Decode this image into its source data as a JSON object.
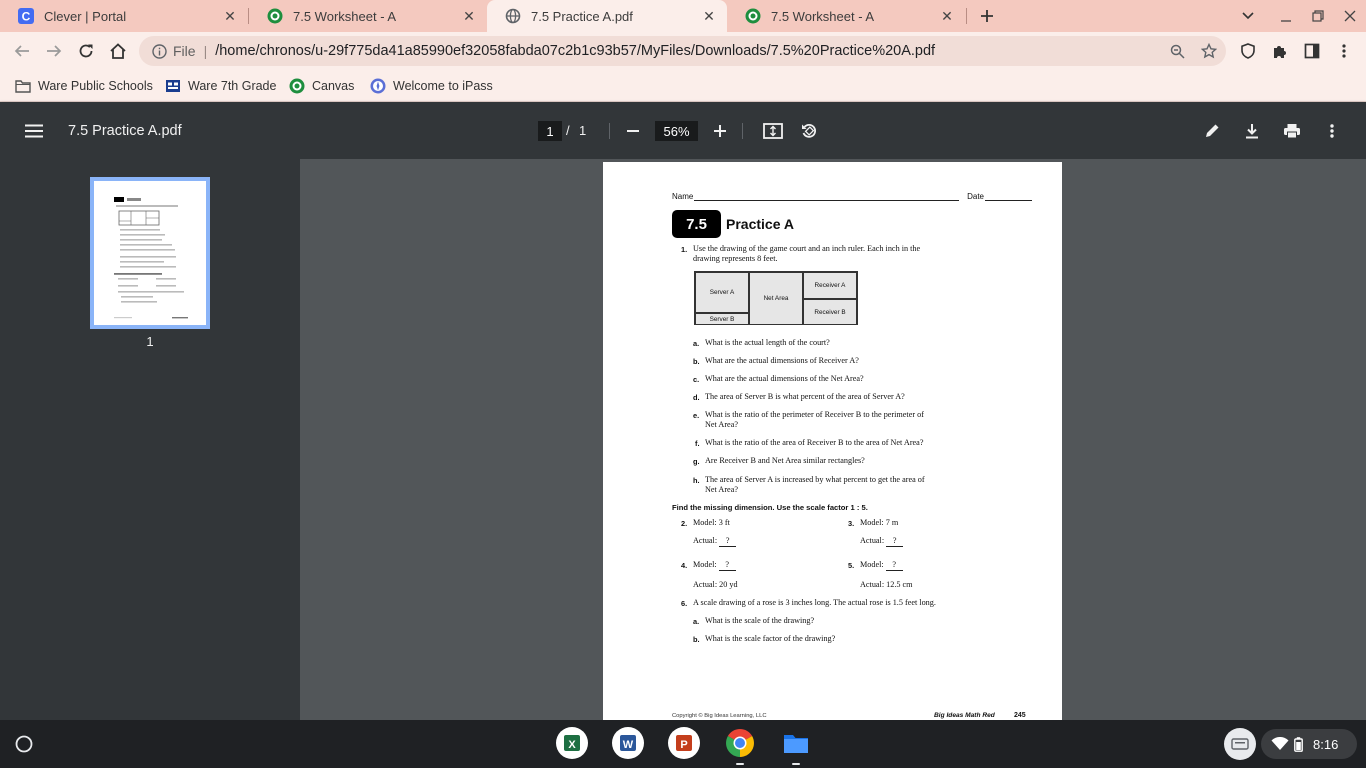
{
  "browser": {
    "tabs": [
      {
        "title": "Clever | Portal",
        "icon": "clever-icon",
        "active": false
      },
      {
        "title": "7.5 Worksheet - A",
        "icon": "worksheet-icon",
        "active": false
      },
      {
        "title": "7.5 Practice A.pdf",
        "icon": "globe-icon",
        "active": true
      },
      {
        "title": "7.5 Worksheet - A",
        "icon": "worksheet-icon",
        "active": false
      }
    ],
    "omnibox": {
      "scheme": "File",
      "url": "/home/chronos/u-29f775da41a85990ef32058fabda07c2b1c93b57/MyFiles/Downloads/7.5%20Practice%20A.pdf"
    },
    "bookmarks": [
      {
        "label": "Ware Public Schools",
        "icon": "folder-icon"
      },
      {
        "label": "Ware 7th Grade",
        "icon": "classroom-icon"
      },
      {
        "label": "Canvas",
        "icon": "worksheet-icon"
      },
      {
        "label": "Welcome to iPass",
        "icon": "ipass-icon"
      }
    ]
  },
  "pdf_viewer": {
    "title": "7.5 Practice A.pdf",
    "current_page": "1",
    "separator": "/",
    "total_pages": "1",
    "zoom": "56%",
    "thumbnail_label": "1"
  },
  "document": {
    "name_label": "Name",
    "date_label": "Date",
    "lesson_badge": "7.5",
    "title": "Practice A",
    "q1": {
      "number": "1.",
      "text_line1": "Use the drawing of the game court and an inch ruler. Each inch in the",
      "text_line2": "drawing represents 8 feet.",
      "court_labels": {
        "server_a": "Server A",
        "server_b": "Server B",
        "net_area": "Net Area",
        "receiver_a": "Receiver A",
        "receiver_b": "Receiver B"
      },
      "parts": [
        {
          "letter": "a.",
          "line1": "What is the actual length of the court?",
          "line2": ""
        },
        {
          "letter": "b.",
          "line1": "What are the actual dimensions of Receiver A?",
          "line2": ""
        },
        {
          "letter": "c.",
          "line1": "What are the actual dimensions of the Net Area?",
          "line2": ""
        },
        {
          "letter": "d.",
          "line1": "The area of Server B is what percent of the area of Server A?",
          "line2": ""
        },
        {
          "letter": "e.",
          "line1": "What is the ratio of the perimeter of Receiver B to the perimeter of",
          "line2": "Net Area?"
        },
        {
          "letter": "f.",
          "line1": "What is the ratio of the area of Receiver B to the area of Net Area?",
          "line2": ""
        },
        {
          "letter": "g.",
          "line1": "Are Receiver B and Net Area similar rectangles?",
          "line2": ""
        },
        {
          "letter": "h.",
          "line1": "The area of Server A is increased by what percent to get the area of",
          "line2": "Net Area?"
        }
      ]
    },
    "section_heading": "Find the missing dimension. Use the scale factor 1 : 5.",
    "q2": {
      "number": "2.",
      "model_label": "Model:",
      "model_value": "3 ft",
      "actual_label": "Actual:",
      "actual_value": "?"
    },
    "q3": {
      "number": "3.",
      "model_label": "Model:",
      "model_value": "7 m",
      "actual_label": "Actual:",
      "actual_value": "?"
    },
    "q4": {
      "number": "4.",
      "model_label": "Model:",
      "model_value": "?",
      "actual_label": "Actual:",
      "actual_value": "20 yd"
    },
    "q5": {
      "number": "5.",
      "model_label": "Model:",
      "model_value": "?",
      "actual_label": "Actual:",
      "actual_value": "12.5 cm"
    },
    "q6": {
      "number": "6.",
      "text": "A scale drawing of a rose is 3 inches long. The actual rose is 1.5 feet long.",
      "parts": [
        {
          "letter": "a.",
          "text": "What is the scale of the drawing?"
        },
        {
          "letter": "b.",
          "text": "What is the scale factor of the drawing?"
        }
      ]
    },
    "footer_left": "Copyright © Big Ideas Learning, LLC",
    "footer_book": "Big Ideas Math Red",
    "footer_page": "245"
  },
  "shelf": {
    "apps": [
      {
        "name": "excel-app-icon",
        "letter": "X",
        "color": "#1d6f42"
      },
      {
        "name": "word-app-icon",
        "letter": "W",
        "color": "#2b579a"
      },
      {
        "name": "powerpoint-app-icon",
        "letter": "P",
        "color": "#c43e1c"
      },
      {
        "name": "chrome-app-icon",
        "letter": "",
        "color": "#4285f4"
      },
      {
        "name": "files-app-icon",
        "letter": "",
        "color": "#1a73e8"
      }
    ],
    "time": "8:16"
  }
}
